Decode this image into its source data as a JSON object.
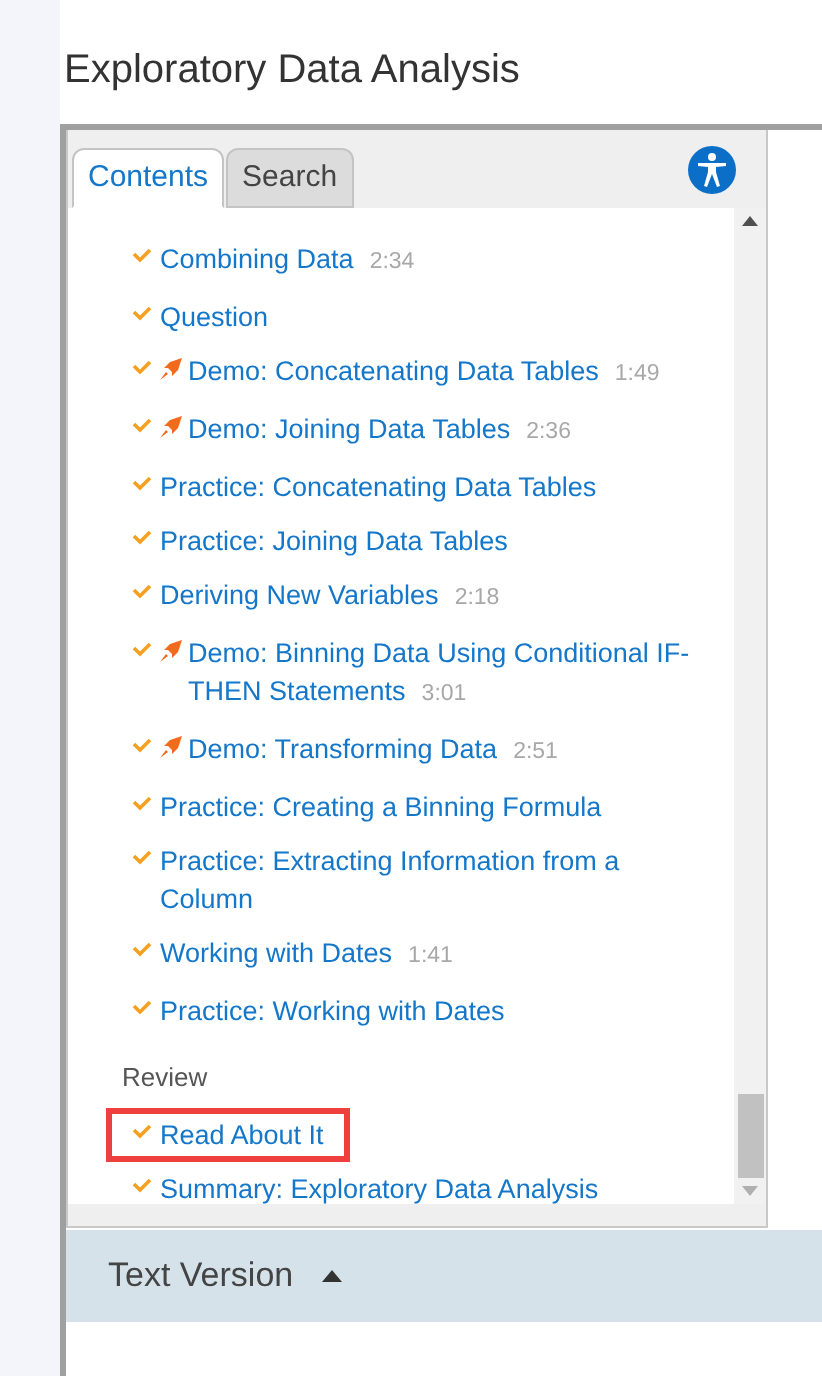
{
  "page_title": "Exploratory Data Analysis",
  "tabs": [
    {
      "label": "Contents",
      "selected": true
    },
    {
      "label": "Search",
      "selected": false
    }
  ],
  "items": [
    {
      "kind": "lesson",
      "title": "Combining Data",
      "duration": "2:34",
      "checked": true,
      "demo": false,
      "highlighted": false
    },
    {
      "kind": "lesson",
      "title": "Question",
      "checked": true,
      "demo": false,
      "highlighted": false
    },
    {
      "kind": "lesson",
      "title": "Demo: Concatenating Data Tables",
      "duration": "1:49",
      "checked": true,
      "demo": true,
      "highlighted": false
    },
    {
      "kind": "lesson",
      "title": "Demo: Joining Data Tables",
      "duration": "2:36",
      "checked": true,
      "demo": true,
      "highlighted": false
    },
    {
      "kind": "lesson",
      "title": "Practice: Concatenating Data Tables",
      "checked": true,
      "demo": false,
      "highlighted": false
    },
    {
      "kind": "lesson",
      "title": "Practice: Joining Data Tables",
      "checked": true,
      "demo": false,
      "highlighted": false
    },
    {
      "kind": "lesson",
      "title": "Deriving New Variables",
      "duration": "2:18",
      "checked": true,
      "demo": false,
      "highlighted": false
    },
    {
      "kind": "lesson",
      "title": "Demo: Binning Data Using Conditional IF-THEN Statements",
      "duration": "3:01",
      "checked": true,
      "demo": true,
      "highlighted": false
    },
    {
      "kind": "lesson",
      "title": "Demo: Transforming Data",
      "duration": "2:51",
      "checked": true,
      "demo": true,
      "highlighted": false
    },
    {
      "kind": "lesson",
      "title": "Practice: Creating a Binning Formula",
      "checked": true,
      "demo": false,
      "highlighted": false
    },
    {
      "kind": "lesson",
      "title": "Practice: Extracting Information from a Column",
      "checked": true,
      "demo": false,
      "highlighted": false
    },
    {
      "kind": "lesson",
      "title": "Working with Dates",
      "duration": "1:41",
      "checked": true,
      "demo": false,
      "highlighted": false
    },
    {
      "kind": "lesson",
      "title": "Practice: Working with Dates",
      "checked": true,
      "demo": false,
      "highlighted": false
    },
    {
      "kind": "section",
      "title": "Review"
    },
    {
      "kind": "lesson",
      "title": "Read About It",
      "checked": true,
      "demo": false,
      "highlighted": true
    },
    {
      "kind": "lesson",
      "title": "Summary: Exploratory Data Analysis",
      "checked": true,
      "demo": false,
      "highlighted": false
    }
  ],
  "text_version": {
    "label": "Text Version",
    "expanded": true
  }
}
